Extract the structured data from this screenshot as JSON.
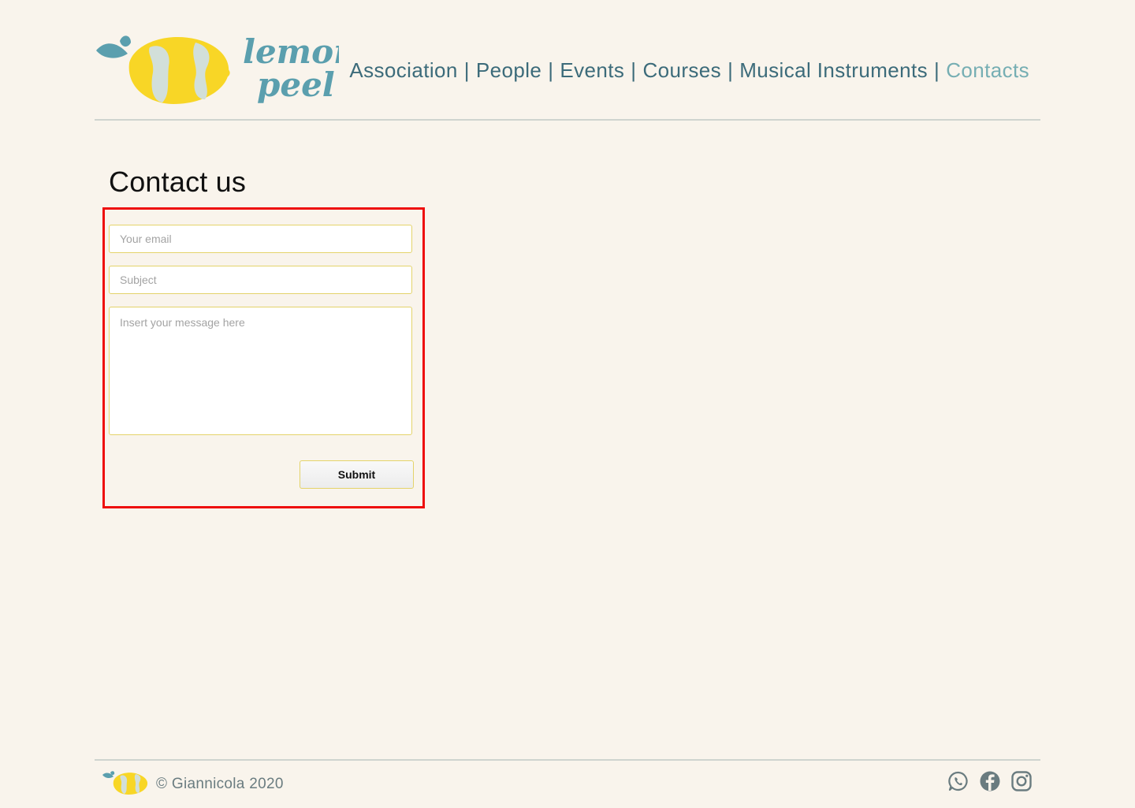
{
  "header": {
    "logo": {
      "text_line1": "lemon",
      "text_line2": "peel",
      "icon": "lemon-logo-icon"
    },
    "nav": [
      {
        "label": "Association",
        "active": false
      },
      {
        "label": "People",
        "active": false
      },
      {
        "label": "Events",
        "active": false
      },
      {
        "label": "Courses",
        "active": false
      },
      {
        "label": "Musical Instruments",
        "active": false
      },
      {
        "label": "Contacts",
        "active": true
      }
    ],
    "nav_separator": "|"
  },
  "main": {
    "title": "Contact us",
    "form": {
      "email_placeholder": "Your email",
      "subject_placeholder": "Subject",
      "message_placeholder": "Insert your message here",
      "submit_label": "Submit"
    }
  },
  "footer": {
    "copyright": "© Giannicola 2020",
    "social": [
      {
        "icon": "whatsapp-icon"
      },
      {
        "icon": "facebook-icon"
      },
      {
        "icon": "instagram-icon"
      }
    ]
  },
  "colors": {
    "background": "#f9f4ec",
    "nav_text": "#3c6b7a",
    "nav_active": "#76aeb3",
    "field_border": "#e4d36a",
    "highlight_frame": "#ee0d0d",
    "lemon_yellow": "#f8d626",
    "leaf_teal": "#5b9fae"
  }
}
